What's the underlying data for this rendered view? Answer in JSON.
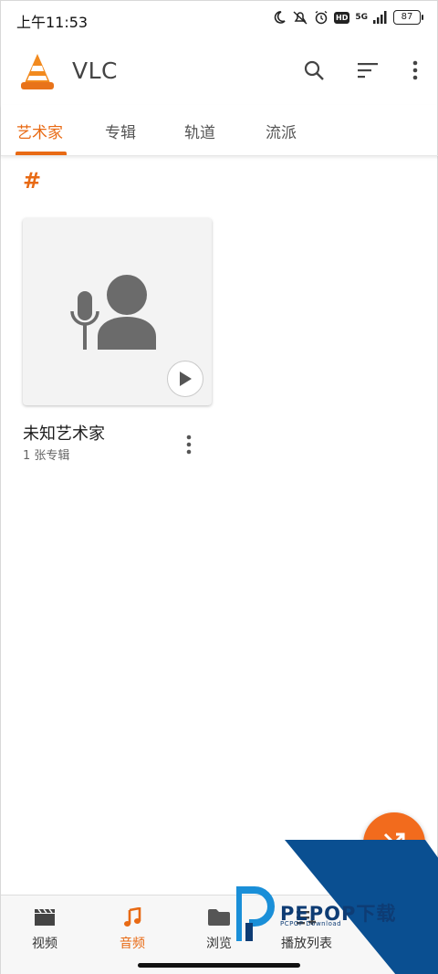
{
  "status_bar": {
    "time": "上午11:53",
    "network": "5G",
    "hd": "HD",
    "battery": "87"
  },
  "app_bar": {
    "title": "VLC",
    "icons": [
      "vlc-cone-icon",
      "search-icon",
      "sort-icon",
      "more-vert-icon"
    ]
  },
  "tabs": [
    {
      "label": "艺术家",
      "active": true
    },
    {
      "label": "专辑",
      "active": false
    },
    {
      "label": "轨道",
      "active": false
    },
    {
      "label": "流派",
      "active": false
    }
  ],
  "section": {
    "header": "#"
  },
  "artists": [
    {
      "name": "未知艺术家",
      "subtitle": "1 张专辑",
      "icon": "unknown-artist-icon"
    }
  ],
  "fab": {
    "icon": "shuffle-icon"
  },
  "bottom_nav": [
    {
      "label": "视频",
      "icon": "movie-icon",
      "active": false
    },
    {
      "label": "音频",
      "icon": "music-note-icon",
      "active": true
    },
    {
      "label": "浏览",
      "icon": "folder-icon",
      "active": false
    },
    {
      "label": "播放列表",
      "icon": "playlist-icon",
      "active": false
    }
  ],
  "watermark": {
    "text": "PEPOP下载",
    "subtext": "PCPOP Download"
  },
  "colors": {
    "accent": "#e86a14",
    "fab": "#f26b1d",
    "watermark": "#0e3c74"
  }
}
